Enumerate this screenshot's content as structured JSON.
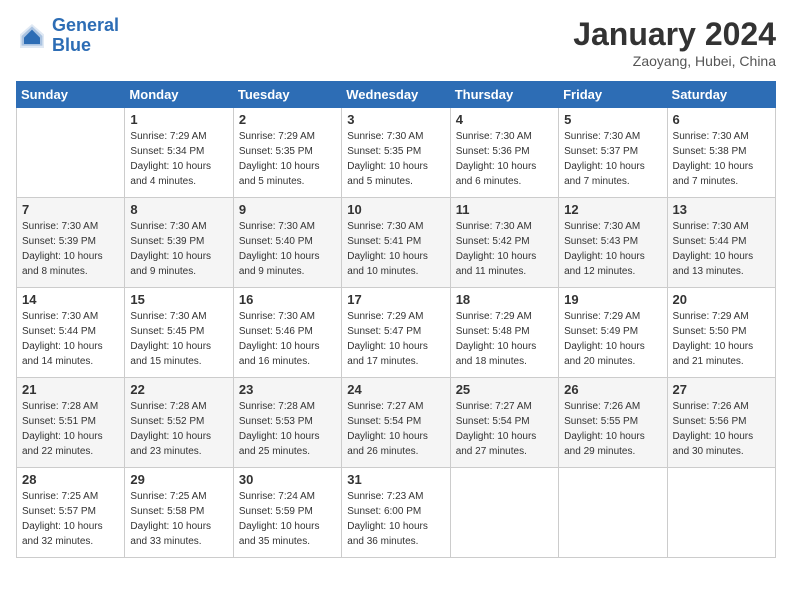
{
  "header": {
    "logo_line1": "General",
    "logo_line2": "Blue",
    "month": "January 2024",
    "location": "Zaoyang, Hubei, China"
  },
  "days_of_week": [
    "Sunday",
    "Monday",
    "Tuesday",
    "Wednesday",
    "Thursday",
    "Friday",
    "Saturday"
  ],
  "weeks": [
    [
      {
        "day": "",
        "info": ""
      },
      {
        "day": "1",
        "info": "Sunrise: 7:29 AM\nSunset: 5:34 PM\nDaylight: 10 hours\nand 4 minutes."
      },
      {
        "day": "2",
        "info": "Sunrise: 7:29 AM\nSunset: 5:35 PM\nDaylight: 10 hours\nand 5 minutes."
      },
      {
        "day": "3",
        "info": "Sunrise: 7:30 AM\nSunset: 5:35 PM\nDaylight: 10 hours\nand 5 minutes."
      },
      {
        "day": "4",
        "info": "Sunrise: 7:30 AM\nSunset: 5:36 PM\nDaylight: 10 hours\nand 6 minutes."
      },
      {
        "day": "5",
        "info": "Sunrise: 7:30 AM\nSunset: 5:37 PM\nDaylight: 10 hours\nand 7 minutes."
      },
      {
        "day": "6",
        "info": "Sunrise: 7:30 AM\nSunset: 5:38 PM\nDaylight: 10 hours\nand 7 minutes."
      }
    ],
    [
      {
        "day": "7",
        "info": "Sunrise: 7:30 AM\nSunset: 5:39 PM\nDaylight: 10 hours\nand 8 minutes."
      },
      {
        "day": "8",
        "info": "Sunrise: 7:30 AM\nSunset: 5:39 PM\nDaylight: 10 hours\nand 9 minutes."
      },
      {
        "day": "9",
        "info": "Sunrise: 7:30 AM\nSunset: 5:40 PM\nDaylight: 10 hours\nand 9 minutes."
      },
      {
        "day": "10",
        "info": "Sunrise: 7:30 AM\nSunset: 5:41 PM\nDaylight: 10 hours\nand 10 minutes."
      },
      {
        "day": "11",
        "info": "Sunrise: 7:30 AM\nSunset: 5:42 PM\nDaylight: 10 hours\nand 11 minutes."
      },
      {
        "day": "12",
        "info": "Sunrise: 7:30 AM\nSunset: 5:43 PM\nDaylight: 10 hours\nand 12 minutes."
      },
      {
        "day": "13",
        "info": "Sunrise: 7:30 AM\nSunset: 5:44 PM\nDaylight: 10 hours\nand 13 minutes."
      }
    ],
    [
      {
        "day": "14",
        "info": "Sunrise: 7:30 AM\nSunset: 5:44 PM\nDaylight: 10 hours\nand 14 minutes."
      },
      {
        "day": "15",
        "info": "Sunrise: 7:30 AM\nSunset: 5:45 PM\nDaylight: 10 hours\nand 15 minutes."
      },
      {
        "day": "16",
        "info": "Sunrise: 7:30 AM\nSunset: 5:46 PM\nDaylight: 10 hours\nand 16 minutes."
      },
      {
        "day": "17",
        "info": "Sunrise: 7:29 AM\nSunset: 5:47 PM\nDaylight: 10 hours\nand 17 minutes."
      },
      {
        "day": "18",
        "info": "Sunrise: 7:29 AM\nSunset: 5:48 PM\nDaylight: 10 hours\nand 18 minutes."
      },
      {
        "day": "19",
        "info": "Sunrise: 7:29 AM\nSunset: 5:49 PM\nDaylight: 10 hours\nand 20 minutes."
      },
      {
        "day": "20",
        "info": "Sunrise: 7:29 AM\nSunset: 5:50 PM\nDaylight: 10 hours\nand 21 minutes."
      }
    ],
    [
      {
        "day": "21",
        "info": "Sunrise: 7:28 AM\nSunset: 5:51 PM\nDaylight: 10 hours\nand 22 minutes."
      },
      {
        "day": "22",
        "info": "Sunrise: 7:28 AM\nSunset: 5:52 PM\nDaylight: 10 hours\nand 23 minutes."
      },
      {
        "day": "23",
        "info": "Sunrise: 7:28 AM\nSunset: 5:53 PM\nDaylight: 10 hours\nand 25 minutes."
      },
      {
        "day": "24",
        "info": "Sunrise: 7:27 AM\nSunset: 5:54 PM\nDaylight: 10 hours\nand 26 minutes."
      },
      {
        "day": "25",
        "info": "Sunrise: 7:27 AM\nSunset: 5:54 PM\nDaylight: 10 hours\nand 27 minutes."
      },
      {
        "day": "26",
        "info": "Sunrise: 7:26 AM\nSunset: 5:55 PM\nDaylight: 10 hours\nand 29 minutes."
      },
      {
        "day": "27",
        "info": "Sunrise: 7:26 AM\nSunset: 5:56 PM\nDaylight: 10 hours\nand 30 minutes."
      }
    ],
    [
      {
        "day": "28",
        "info": "Sunrise: 7:25 AM\nSunset: 5:57 PM\nDaylight: 10 hours\nand 32 minutes."
      },
      {
        "day": "29",
        "info": "Sunrise: 7:25 AM\nSunset: 5:58 PM\nDaylight: 10 hours\nand 33 minutes."
      },
      {
        "day": "30",
        "info": "Sunrise: 7:24 AM\nSunset: 5:59 PM\nDaylight: 10 hours\nand 35 minutes."
      },
      {
        "day": "31",
        "info": "Sunrise: 7:23 AM\nSunset: 6:00 PM\nDaylight: 10 hours\nand 36 minutes."
      },
      {
        "day": "",
        "info": ""
      },
      {
        "day": "",
        "info": ""
      },
      {
        "day": "",
        "info": ""
      }
    ]
  ]
}
